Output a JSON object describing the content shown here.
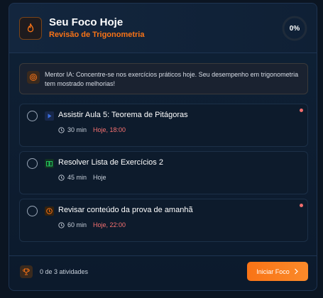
{
  "header": {
    "title": "Seu Foco Hoje",
    "subtitle": "Revisão de Trigonometria",
    "progress_label": "0%",
    "progress_value": 0
  },
  "mentor": {
    "text": "Mentor IA: Concentre-se nos exercícios práticos hoje. Seu desempenho em trigonometria tem mostrado melhorias!"
  },
  "tasks": [
    {
      "title": "Assistir Aula 5: Teorema de Pitágoras",
      "duration": "30 min",
      "due": "Hoje, 18:00",
      "icon": "play-icon",
      "urgent": true
    },
    {
      "title": "Resolver Lista de Exercícios 2",
      "duration": "45 min",
      "due": "Hoje",
      "icon": "book-icon",
      "urgent": false
    },
    {
      "title": "Revisar conteúdo da prova de amanhã",
      "duration": "60 min",
      "due": "Hoje, 22:00",
      "icon": "clock-icon",
      "urgent": true
    }
  ],
  "footer": {
    "count": "0 de 3 atividades",
    "button_label": "Iniciar Foco"
  },
  "colors": {
    "accent": "#f97316",
    "urgent": "#f87171",
    "play": "#3b6fe0",
    "book": "#22c55e"
  }
}
